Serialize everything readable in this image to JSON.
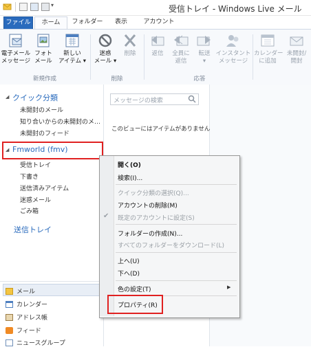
{
  "titlebar": {
    "title": "受信トレイ - Windows Live メール"
  },
  "tabs": [
    {
      "label": "ファイル"
    },
    {
      "label": "ホーム"
    },
    {
      "label": "フォルダー"
    },
    {
      "label": "表示"
    },
    {
      "label": "アカウント"
    }
  ],
  "ribbon": {
    "email_message": "電子メール\nメッセージ",
    "photo_mail": "フォト\nメール",
    "new_item": "新しい\nアイテム ▾",
    "junk": "迷惑\nメール ▾",
    "delete": "削除",
    "reply": "返信",
    "reply_all": "全員に\n返信",
    "forward": "転送\n▾",
    "instant_message": "インスタント\nメッセージ",
    "add_calendar": "カレンダー\nに追加",
    "unread_read": "未開封/\n開封",
    "group_new": "新規作成",
    "group_delete": "削除",
    "group_respond": "応答"
  },
  "leftpane": {
    "quick_views": "クイック分類",
    "qv_items": [
      "未開封のメール",
      "知り合いからの未開封のメ…",
      "未開封のフィード"
    ],
    "account": "Fmworld (fmv)",
    "folders": [
      "受信トレイ",
      "下書き",
      "送信済みアイテム",
      "迷惑メール",
      "ごみ箱"
    ],
    "outbox": "送信トレイ"
  },
  "bottomnav": [
    "メール",
    "カレンダー",
    "アドレス帳",
    "フィード",
    "ニュースグループ"
  ],
  "search": {
    "placeholder": "メッセージの検索"
  },
  "message_list": {
    "empty_text": "このビューにはアイテムがありません。"
  },
  "context_menu": {
    "items": [
      "開く(O)",
      "検索(I)...",
      "クイック分類の選択(Q)...",
      "アカウントの削除(M)",
      "既定のアカウントに設定(S)",
      "フォルダーの作成(N)...",
      "すべてのフォルダーをダウンロード(L)",
      "上へ(U)",
      "下へ(D)",
      "色の設定(T)",
      "プロパティ(R)"
    ]
  },
  "colors": {
    "accent": "#2a6bbd",
    "highlight_box": "#e02020"
  }
}
